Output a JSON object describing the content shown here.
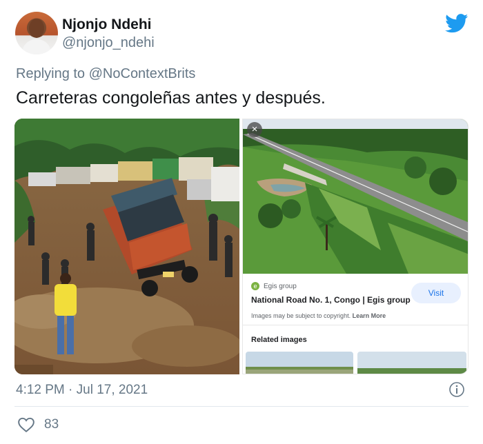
{
  "author": {
    "display_name": "Njonjo Ndehi",
    "handle": "@njonjo_ndehi",
    "avatar_icon": "profile-photo"
  },
  "reply": {
    "prefix": "Replying to",
    "mention": "@NoContextBrits"
  },
  "tweet_text": "Carreteras congoleñas antes y después.",
  "media": {
    "left_image": "muddy-road-truck-photo",
    "right_panel": {
      "close_icon": "×",
      "source_name": "Egis group",
      "source_icon_letter": "e",
      "title": "National Road No. 1, Congo | Egis group",
      "visit_label": "Visit",
      "copyright_text": "Images may be subject to copyright.",
      "learn_more": "Learn More",
      "related_label": "Related images"
    }
  },
  "footer": {
    "timestamp": "4:12 PM · Jul 17, 2021",
    "like_count": "83"
  },
  "colors": {
    "twitter_blue": "#1d9bf0",
    "secondary_text": "#657786",
    "link_blue": "#1a73e8"
  }
}
